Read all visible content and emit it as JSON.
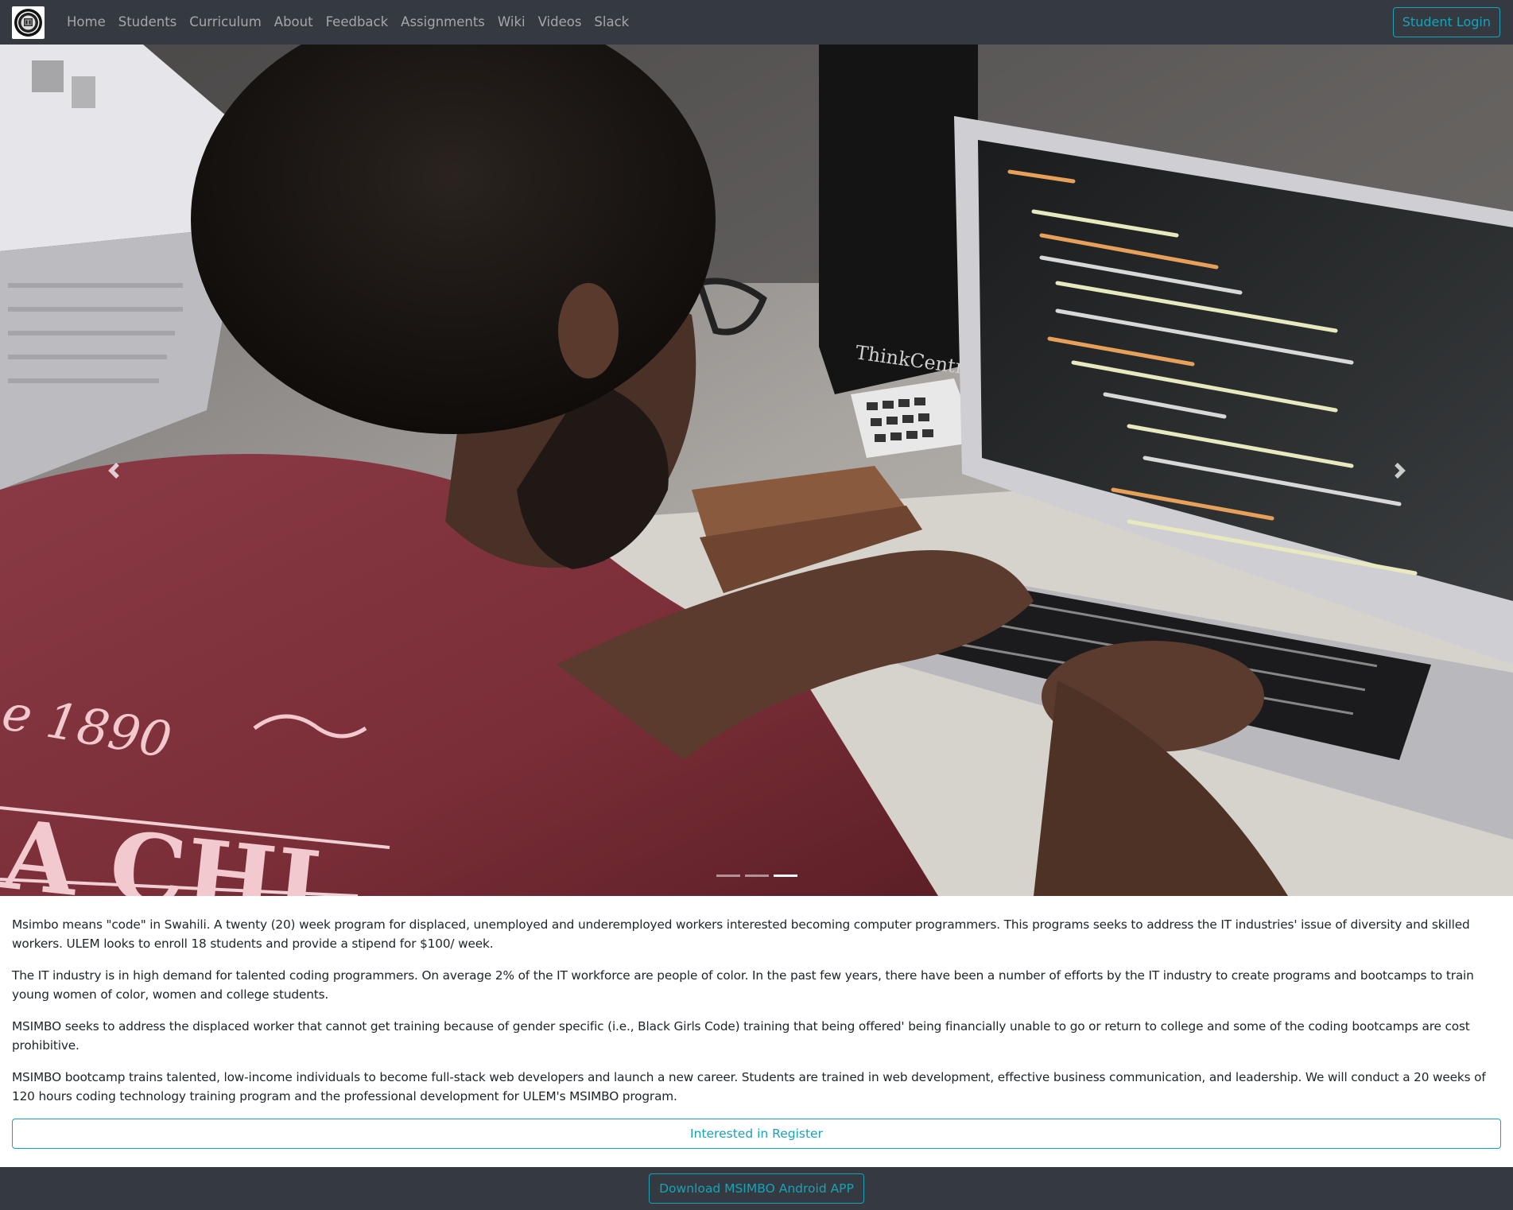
{
  "navbar": {
    "brand_icon": "msimbo-logo-icon",
    "links": [
      {
        "label": "Home"
      },
      {
        "label": "Students"
      },
      {
        "label": "Curriculum"
      },
      {
        "label": "About"
      },
      {
        "label": "Feedback"
      },
      {
        "label": "Assignments"
      },
      {
        "label": "Wiki"
      },
      {
        "label": "Videos"
      },
      {
        "label": "Slack"
      }
    ],
    "login_label": "Student Login"
  },
  "carousel": {
    "prev_icon": "chevron-left-icon",
    "next_icon": "chevron-right-icon",
    "slide_count": 3,
    "active_slide": 3
  },
  "content": {
    "paragraphs": [
      "Msimbo means \"code\" in Swahili. A twenty (20) week program for displaced, unemployed and underemployed workers interested becoming computer programmers. This programs seeks to address the IT industries' issue of diversity and skilled workers. ULEM looks to enroll 18 students and provide a stipend for $100/ week.",
      "The IT industry is in high demand for talented coding programmers. On average 2% of the IT workforce are people of color. In the past few years, there have been a number of efforts by the IT industry to create programs and bootcamps to train young women of color, women and college students.",
      "MSIMBO seeks to address the displaced worker that cannot get training because of gender specific (i.e., Black Girls Code) training that being offered' being financially unable to go or return to college and some of the coding bootcamps are cost prohibitive.",
      "MSIMBO bootcamp trains talented, low-income individuals to become full-stack web developers and launch a new career. Students are trained in web development, effective business communication, and leadership. We will conduct a 20 weeks of 120 hours coding technology training program and the professional development for ULEM's MSIMBO program."
    ],
    "register_label": "Interested in Register"
  },
  "footer": {
    "download_label": "Download MSIMBO Android APP"
  },
  "colors": {
    "navbar_bg": "#343a40",
    "accent": "#17a2b8",
    "nav_text": "rgba(255,255,255,0.55)"
  }
}
